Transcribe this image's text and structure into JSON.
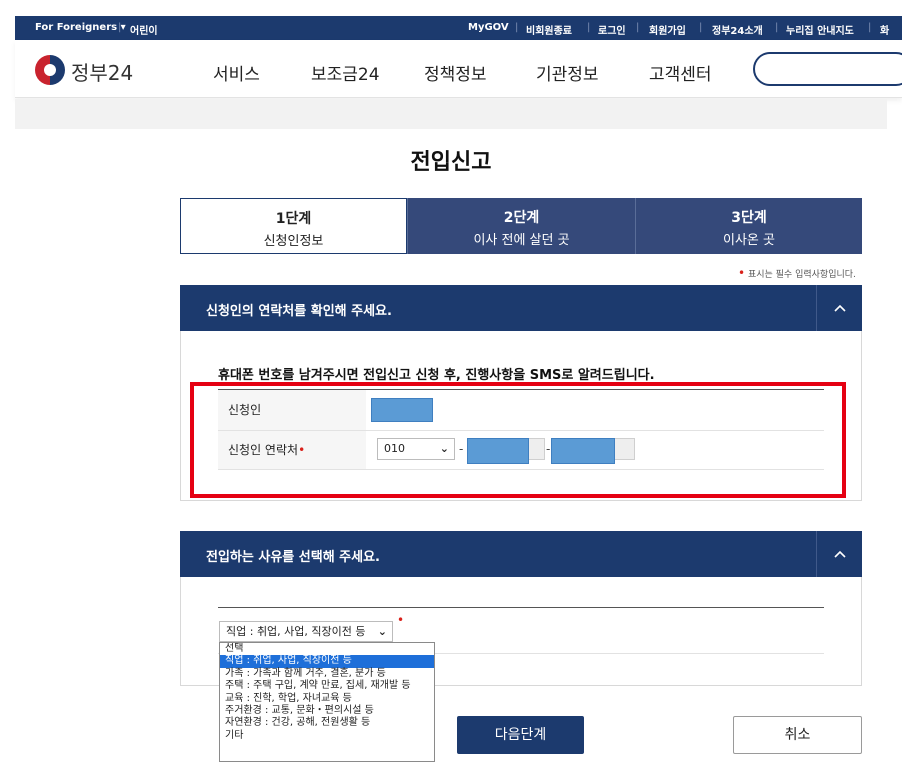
{
  "topbar": {
    "for_foreigners": "For Foreigners ▾",
    "kids": "어린이",
    "mygov": "MyGOV",
    "non_member": "비회원종료",
    "login": "로그인",
    "signup": "회원가입",
    "about": "정부24소개",
    "accessibility": "누리집 안내지도",
    "more": "화"
  },
  "header": {
    "logo": "정부24",
    "nav": [
      "서비스",
      "보조금24",
      "정책정보",
      "기관정보",
      "고객센터"
    ]
  },
  "page": {
    "title": "전입신고",
    "required_note": "표시는 필수 입력사항입니다."
  },
  "steps": [
    {
      "num": "1단계",
      "label": "신청인정보"
    },
    {
      "num": "2단계",
      "label": "이사 전에 살던 곳"
    },
    {
      "num": "3단계",
      "label": "이사온 곳"
    }
  ],
  "contact_section": {
    "title": "신청인의 연락처를 확인해 주세요.",
    "toggle": "^",
    "notice": "휴대폰 번호를 남겨주시면 전입신고 신청 후, 진행사항을 SMS로 알려드립니다.",
    "applicant_label": "신청인",
    "phone_label": "신청인 연락처",
    "required_mark": "•",
    "phone_prefix": "010",
    "dash": "-"
  },
  "reason_section": {
    "title": "전입하는 사유를 선택해 주세요.",
    "toggle": "^",
    "selected": "직업 : 취업, 사업, 직장이전 등",
    "required_mark": "•",
    "options": [
      "선택",
      "직업 : 취업, 사업, 직장이전 등",
      "가족 : 가족과 함께 거주, 결혼, 분가 등",
      "주택 : 주택 구입, 계약 만료, 집세, 재개발 등",
      "교육 : 진학, 학업, 자녀교육 등",
      "주거환경 : 교통, 문화・편의시설 등",
      "자연환경 : 건강, 공해, 전원생활 등",
      "기타"
    ],
    "selected_index": 1
  },
  "buttons": {
    "next": "다음단계",
    "cancel": "취소"
  },
  "colors": {
    "navy": "#1c3a6e",
    "step_inactive": "#35497a",
    "highlight_red": "#e50012",
    "mask_blue": "#5b9bd5"
  }
}
